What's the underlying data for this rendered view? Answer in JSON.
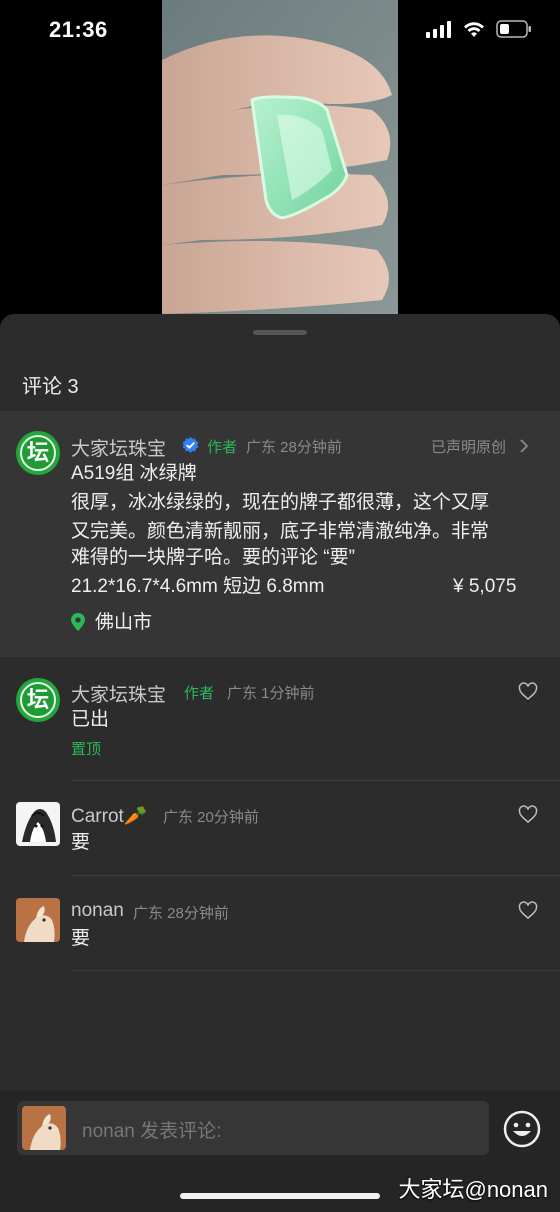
{
  "status_bar": {
    "time": "21:36"
  },
  "sheet": {
    "title": "评论 3"
  },
  "post": {
    "author": "大家坛珠宝",
    "author_tag": "作者",
    "region_time": "广东 28分钟前",
    "original_label": "已声明原创",
    "title_line": "A519组 冰绿牌",
    "body_line1": "很厚，冰冰绿绿的，现在的牌子都很薄，这个又厚",
    "body_line2": "又完美。颜色清新靓丽，底子非常清澈纯净。非常",
    "body_line3": "难得的一块牌子哈。要的评论 “要”",
    "spec": "21.2*16.7*4.6mm 短边 6.8mm",
    "price": "¥ 5,075",
    "location": "佛山市"
  },
  "comments": [
    {
      "name": "大家坛珠宝",
      "tag": "作者",
      "meta": "广东 1分钟前",
      "text": "已出",
      "extra": "置顶"
    },
    {
      "name": "Carrot🥕",
      "meta": "广东 20分钟前",
      "text": "要"
    },
    {
      "name": "nonan",
      "meta": "广东 28分钟前",
      "text": "要"
    }
  ],
  "input": {
    "placeholder": "nonan 发表评论:"
  },
  "watermark": "大家坛@nonan",
  "logo_glyph": "坛",
  "colors": {
    "accent_green": "#2ab85a",
    "verified_blue": "#2f7ff7",
    "sheet_bg": "#2c2c2c",
    "post_bg": "#353535"
  }
}
